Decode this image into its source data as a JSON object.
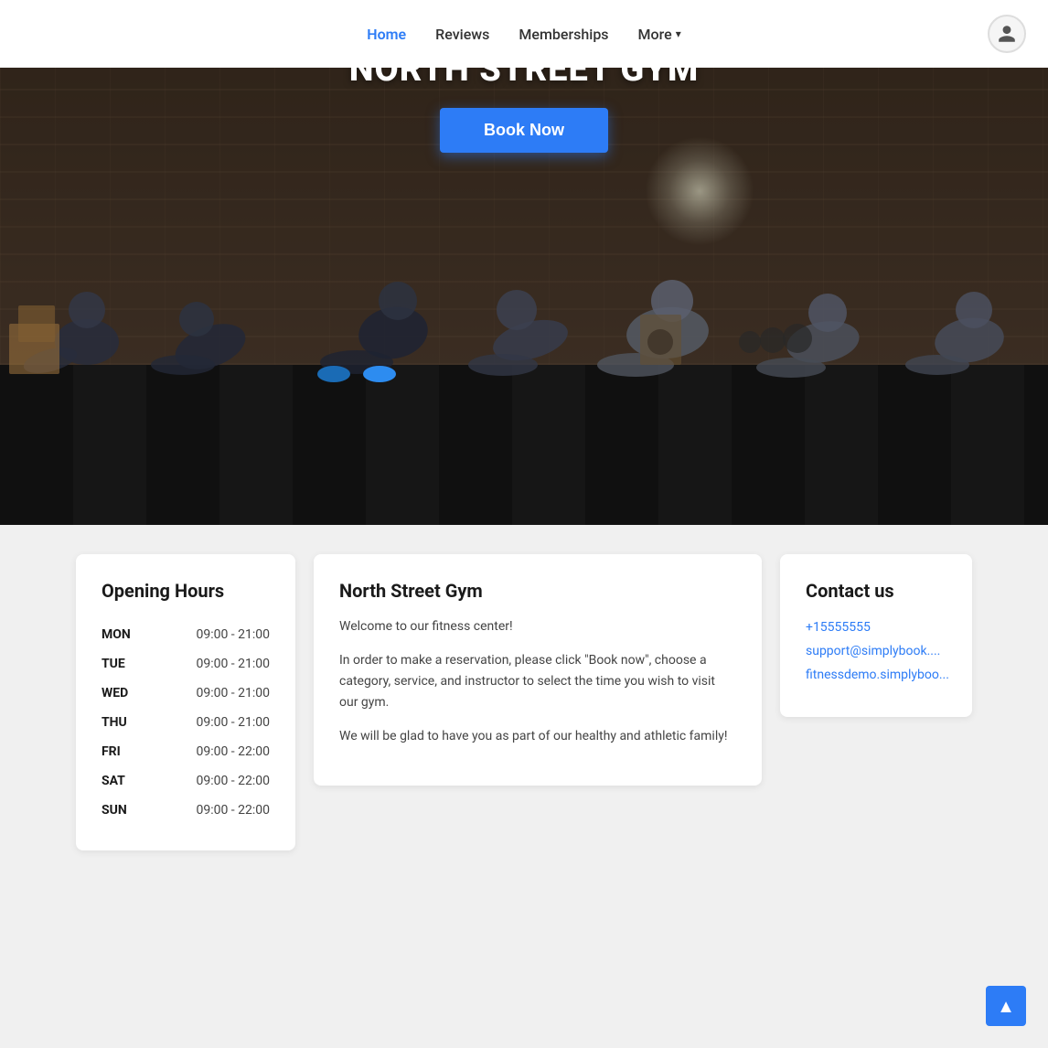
{
  "navbar": {
    "links": [
      {
        "label": "Home",
        "active": true
      },
      {
        "label": "Reviews",
        "active": false
      },
      {
        "label": "Memberships",
        "active": false
      },
      {
        "label": "More",
        "active": false,
        "hasDropdown": true
      }
    ]
  },
  "hero": {
    "title": "NORTH STREET GYM",
    "book_button": "Book Now"
  },
  "opening_hours": {
    "card_title": "Opening Hours",
    "rows": [
      {
        "day": "MON",
        "hours": "09:00 - 21:00"
      },
      {
        "day": "TUE",
        "hours": "09:00 - 21:00"
      },
      {
        "day": "WED",
        "hours": "09:00 - 21:00"
      },
      {
        "day": "THU",
        "hours": "09:00 - 21:00"
      },
      {
        "day": "FRI",
        "hours": "09:00 - 22:00"
      },
      {
        "day": "SAT",
        "hours": "09:00 - 22:00"
      },
      {
        "day": "SUN",
        "hours": "09:00 - 22:00"
      }
    ]
  },
  "info": {
    "card_title": "North Street Gym",
    "welcome": "Welcome to our fitness center!",
    "paragraph1": "In order to make a reservation, please click \"Book now\", choose a category, service, and instructor to select the time you wish to visit our gym.",
    "paragraph2": "We will be glad to have you as part of our healthy and athletic family!"
  },
  "contact": {
    "card_title": "Contact us",
    "phone": "+15555555",
    "email": "support@simplybook....",
    "website": "fitnessdemo.simplyboo..."
  },
  "scroll_top": {
    "icon": "▲"
  }
}
